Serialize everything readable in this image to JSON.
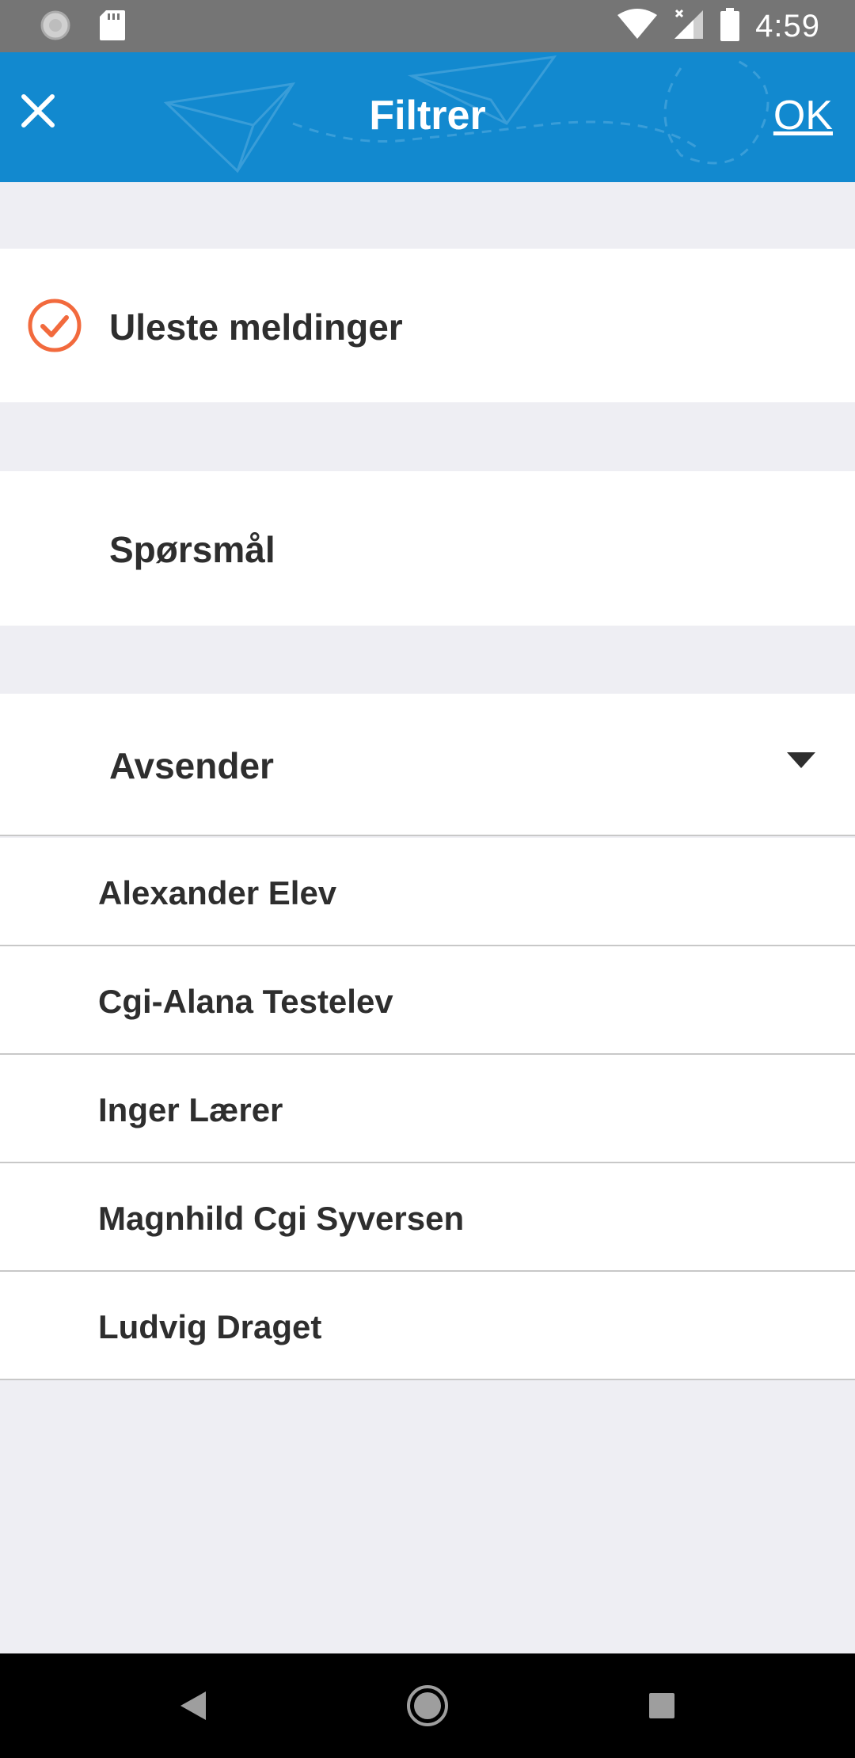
{
  "status_bar": {
    "time": "4:59"
  },
  "header": {
    "title": "Filtrer",
    "ok_label": "OK"
  },
  "filters": {
    "unread_label": "Uleste meldinger",
    "unread_checked": true,
    "questions_label": "Spørsmål",
    "sender_label": "Avsender"
  },
  "senders": [
    {
      "name": "Alexander Elev"
    },
    {
      "name": "Cgi-Alana Testelev"
    },
    {
      "name": "Inger Lærer"
    },
    {
      "name": "Magnhild Cgi Syversen"
    },
    {
      "name": "Ludvig Draget"
    }
  ],
  "colors": {
    "header_blue": "#1289cf",
    "check_orange": "#f26a3d",
    "background": "#eeeef3"
  }
}
